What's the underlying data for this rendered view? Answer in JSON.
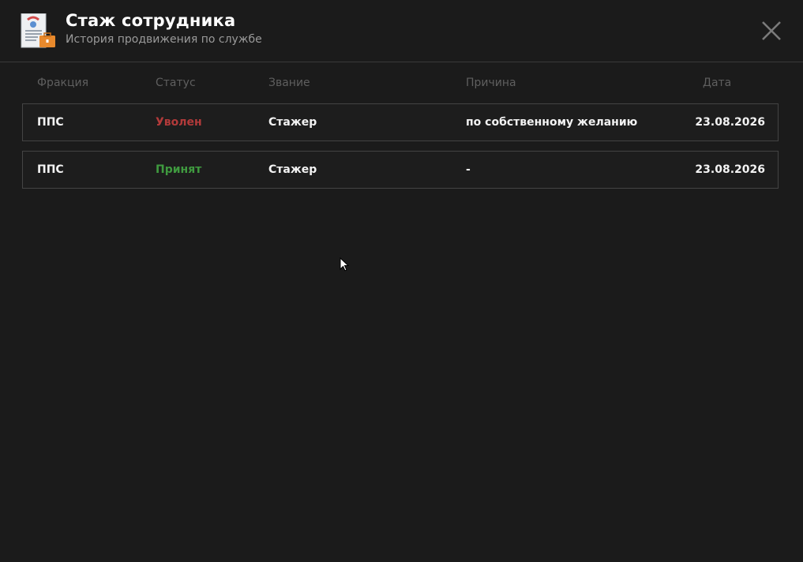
{
  "header": {
    "title": "Стаж сотрудника",
    "subtitle": "История продвижения по службе",
    "icon": "document-briefcase-icon",
    "close_icon": "close-icon"
  },
  "table": {
    "columns": [
      "Фракция",
      "Статус",
      "Звание",
      "Причина",
      "Дата"
    ],
    "rows": [
      {
        "faction": "ППС",
        "status": "Уволен",
        "status_color": "#b23a3a",
        "rank": "Стажер",
        "reason": "по собственному желанию",
        "date": "23.08.2026"
      },
      {
        "faction": "ППС",
        "status": "Принят",
        "status_color": "#3f9a3f",
        "rank": "Стажер",
        "reason": "-",
        "date": "23.08.2026"
      }
    ]
  },
  "colors": {
    "background": "#1b1b1b",
    "title": "#ffffff",
    "subtitle": "#9a9a9a",
    "column_header": "#5f5f5f",
    "row_border": "#444444"
  }
}
